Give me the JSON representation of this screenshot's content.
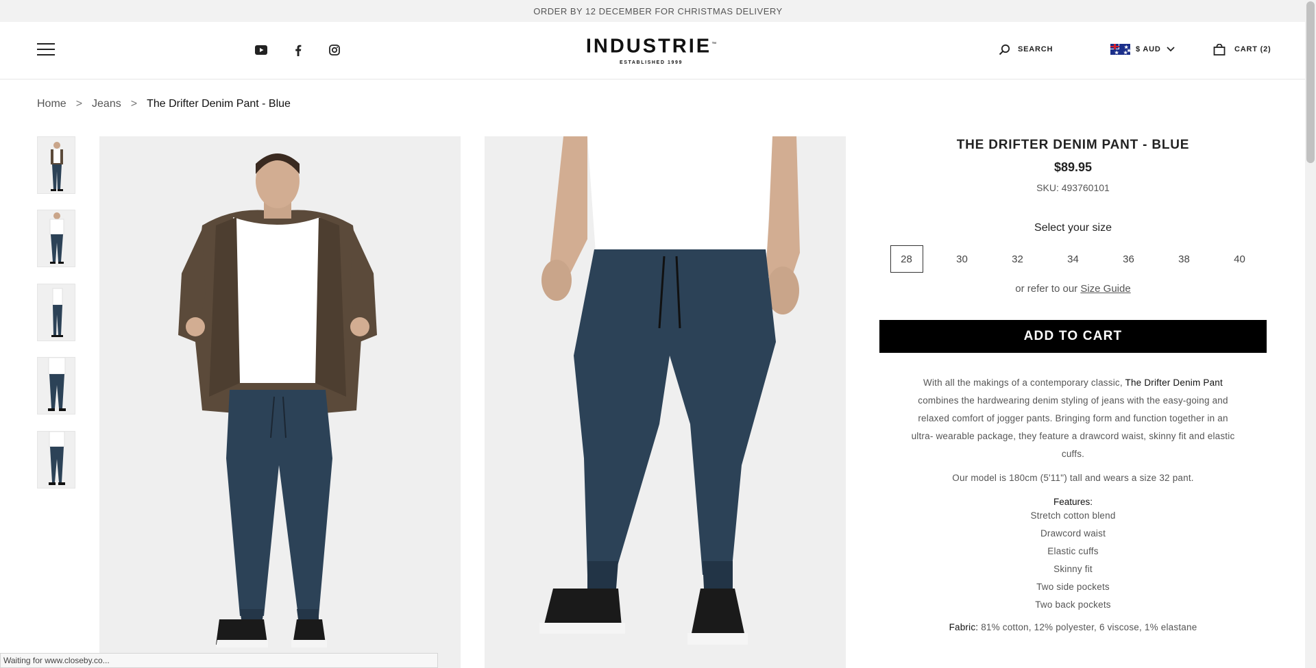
{
  "announcement": "ORDER BY 12 DECEMBER FOR CHRISTMAS DELIVERY",
  "header": {
    "logo": "INDUSTRIE",
    "logo_tm": "™",
    "logo_sub": "ESTABLISHED 1999",
    "search_label": "SEARCH",
    "currency_label": "$ AUD",
    "cart_label": "CART (2)"
  },
  "icons": {
    "menu": "hamburger-icon",
    "youtube": "youtube-icon",
    "facebook": "facebook-icon",
    "instagram": "instagram-icon",
    "search": "search-icon",
    "flag": "australia-flag-icon",
    "chevron": "chevron-down-icon",
    "cart": "bag-icon"
  },
  "breadcrumb": {
    "home": "Home",
    "sep1": ">",
    "category": "Jeans",
    "sep2": ">",
    "current": "The Drifter Denim Pant - Blue"
  },
  "product": {
    "title": "THE DRIFTER DENIM PANT - BLUE",
    "price": "$89.95",
    "sku": "SKU: 493760101",
    "select_size_label": "Select your size",
    "sizes": [
      "28",
      "30",
      "32",
      "34",
      "36",
      "38",
      "40"
    ],
    "selected_size": "28",
    "refer_text": "or refer to our",
    "size_guide_link": "Size Guide",
    "add_to_cart": "ADD TO CART",
    "desc_pre": "With all the makings of a contemporary classic,",
    "desc_name": "The Drifter Denim Pant",
    "desc_post": "combines the hardwearing denim styling of jeans with the easy-going and relaxed comfort of jogger pants. Bringing form and function together in an ultra- wearable package, they feature a drawcord waist, skinny fit and elastic cuffs.",
    "model_note": "Our model is 180cm (5'11\") tall and wears a size 32 pant.",
    "features_heading": "Features:",
    "features": [
      "Stretch cotton blend",
      "Drawcord waist",
      "Elastic cuffs",
      "Skinny fit",
      "Two side pockets",
      "Two back pockets"
    ],
    "fabric_label": "Fabric:",
    "fabric_value": "81% cotton, 12% polyester, 6 viscose, 1% elastane"
  },
  "status_bar": "Waiting for www.closeby.co...",
  "colors": {
    "announcement_bg": "#f2f2f2",
    "button_bg": "#000000",
    "denim": "#2c4257",
    "shirt": "#ffffff",
    "jacket": "#5b4a3a"
  }
}
